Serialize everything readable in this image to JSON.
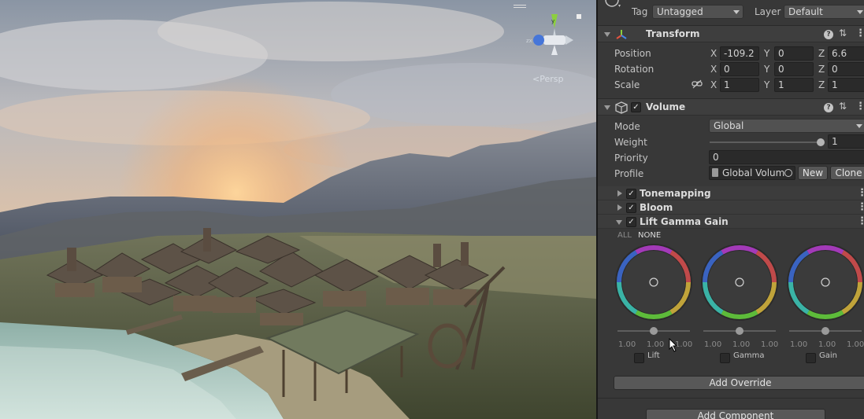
{
  "scene": {
    "view_mode": "<Persp",
    "gizmo_axes": [
      "y",
      "z",
      "x"
    ]
  },
  "inspector": {
    "tag_label": "Tag",
    "tag_value": "Untagged",
    "layer_label": "Layer",
    "layer_value": "Default",
    "transform": {
      "title": "Transform",
      "position_label": "Position",
      "rotation_label": "Rotation",
      "scale_label": "Scale",
      "position": {
        "x": "-109.2",
        "y": "0",
        "z": "6.6"
      },
      "rotation": {
        "x": "0",
        "y": "0",
        "z": "0"
      },
      "scale": {
        "x": "1",
        "y": "1",
        "z": "1"
      },
      "axis_x": "X",
      "axis_y": "Y",
      "axis_z": "Z"
    },
    "volume": {
      "title": "Volume",
      "mode_label": "Mode",
      "mode_value": "Global",
      "weight_label": "Weight",
      "weight_value": "1",
      "priority_label": "Priority",
      "priority_value": "0",
      "profile_label": "Profile",
      "profile_value": "Global Volum",
      "new_button": "New",
      "clone_button": "Clone"
    },
    "overrides": [
      {
        "label": "Tonemapping",
        "expanded": false,
        "enabled": true
      },
      {
        "label": "Bloom",
        "expanded": false,
        "enabled": true
      },
      {
        "label": "Lift Gamma Gain",
        "expanded": true,
        "enabled": true
      }
    ],
    "lgg": {
      "all_label": "ALL",
      "none_label": "NONE",
      "wheels": [
        {
          "name": "Lift",
          "values": [
            "1.00",
            "1.00",
            "1.00"
          ]
        },
        {
          "name": "Gamma",
          "values": [
            "1.00",
            "1.00",
            "1.00"
          ]
        },
        {
          "name": "Gain",
          "values": [
            "1.00",
            "1.00",
            "1.00"
          ]
        }
      ]
    },
    "add_override_button": "Add Override",
    "add_component_button": "Add Component"
  },
  "icons": {
    "transform": "transform-axes-icon",
    "volume": "volume-cube-icon",
    "help": "help-icon",
    "presets": "presets-sliders-icon",
    "menu": "kebab-menu-icon",
    "constrain": "link-icon",
    "object_picker": "target-icon"
  }
}
